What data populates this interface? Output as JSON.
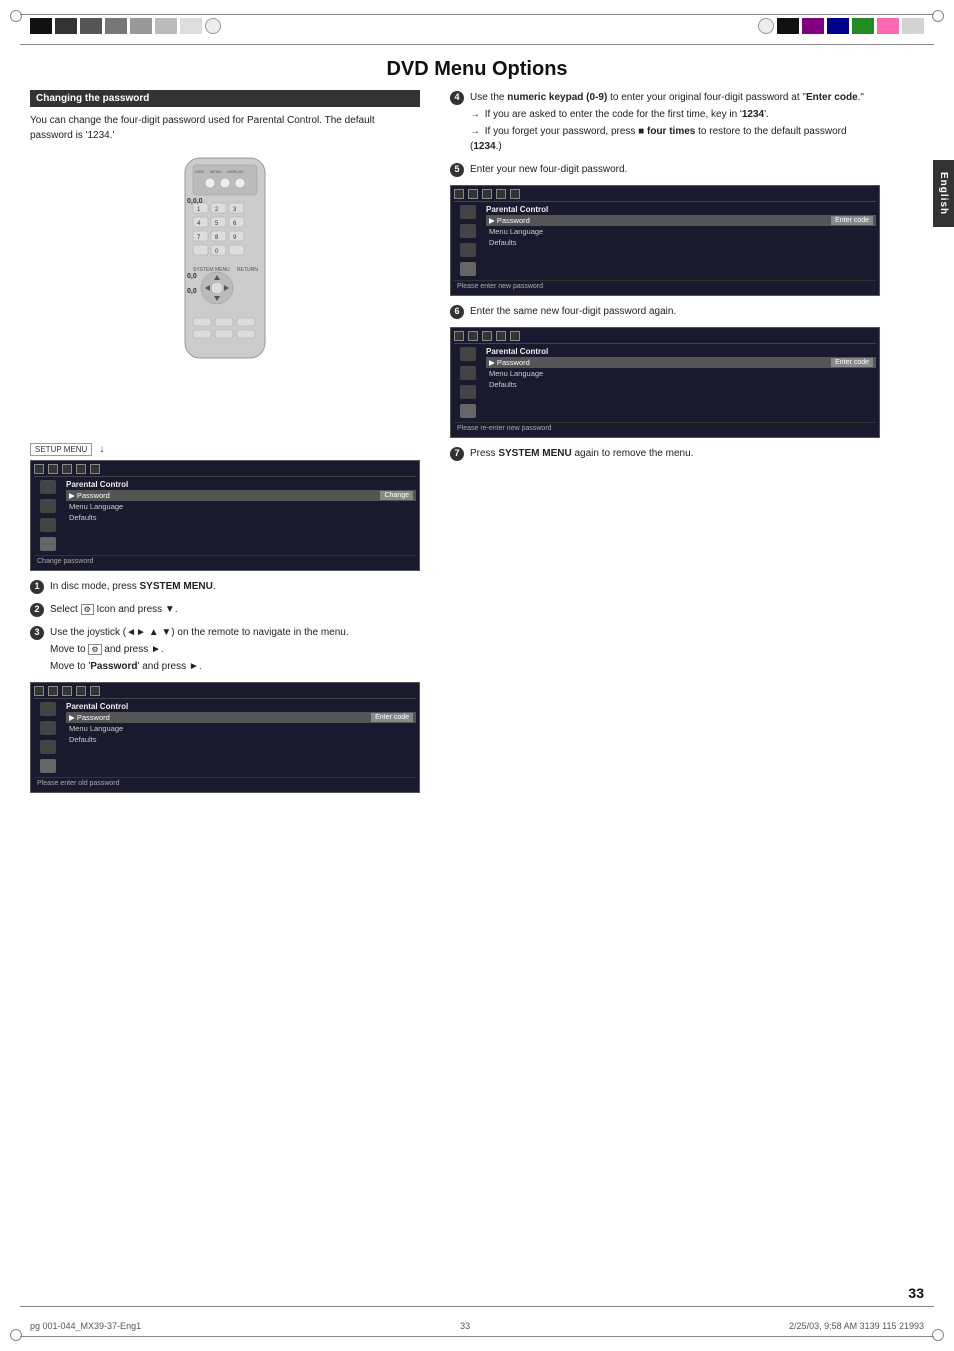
{
  "page": {
    "title": "DVD Menu Options",
    "page_number": "33",
    "english_label": "English",
    "footer_left": "pg 001-044_MX39-37-Eng1",
    "footer_center": "33",
    "footer_right": "2/25/03, 9:58 AM   3139 115 21993"
  },
  "top_bars_left": [
    {
      "color": "#222"
    },
    {
      "color": "#444"
    },
    {
      "color": "#666"
    },
    {
      "color": "#888"
    },
    {
      "color": "#aaa"
    },
    {
      "color": "#ccc"
    },
    {
      "color": "#eee"
    }
  ],
  "top_bars_right": [
    {
      "color": "#222"
    },
    {
      "color": "#800080"
    },
    {
      "color": "#00008b"
    },
    {
      "color": "#008000"
    },
    {
      "color": "#ff69b4"
    },
    {
      "color": "#d3d3d3"
    }
  ],
  "left_section": {
    "header": "Changing the password",
    "intro": "You can change the four-digit password used for Parental Control. The default password is '1234.'",
    "setup_menu_label": "SETUP MENU",
    "steps": [
      {
        "num": "1",
        "text": "In disc mode, press ",
        "bold": "SYSTEM MENU",
        "text2": "."
      },
      {
        "num": "2",
        "text": "Select ",
        "icon_desc": "setup icon",
        "text2": " icon and press ▼."
      },
      {
        "num": "3",
        "text": "Use the joystick (◄► ▲ ▼) on the remote to navigate in the menu.",
        "sub1": "Move to ",
        "sub1_bold": "setup",
        "sub1_text2": " and press ►.",
        "sub2": "Move to '",
        "sub2_bold": "Password",
        "sub2_text2": "' and press ►."
      }
    ],
    "mini_menu_1": {
      "items": [
        "Parental Control",
        "Password",
        "Menu Language",
        "Defaults"
      ],
      "selected": 1,
      "enter_label": "Enter code",
      "bottom_text": "Please enter old password"
    }
  },
  "right_section": {
    "steps": [
      {
        "num": "4",
        "text": "Use the ",
        "bold1": "numeric keypad (0-9)",
        "text2": " to enter your original four-digit password at \"",
        "bold2": "Enter code",
        "text3": "\"",
        "sub1": "→ If you are asked to enter the code for the first time, key in '",
        "sub1_bold": "1234",
        "sub1_text2": "'.",
        "sub2": "→ If you forget your password, press ■ ",
        "sub2_bold": "four times",
        "sub2_text2": " to restore to the default password (",
        "sub2_bold2": "1234",
        "sub2_text3": ".)"
      },
      {
        "num": "5",
        "text": "Enter your new four-digit password.",
        "mini_menu": {
          "items": [
            "Parental Control",
            "Password",
            "Menu Language",
            "Defaults"
          ],
          "selected": 1,
          "enter_label": "Enter code",
          "bottom_text": "Please enter new password"
        }
      },
      {
        "num": "6",
        "text": "Enter the same new four-digit password again.",
        "mini_menu": {
          "items": [
            "Parental Control",
            "Password",
            "Menu Language",
            "Defaults"
          ],
          "selected": 1,
          "enter_label": "Enter code",
          "bottom_text": "Please re-enter new password"
        }
      },
      {
        "num": "7",
        "text": "Press ",
        "bold": "SYSTEM MENU",
        "text2": " again to remove the menu."
      }
    ]
  }
}
